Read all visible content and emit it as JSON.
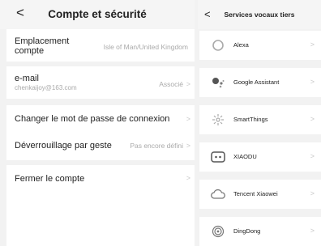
{
  "left": {
    "back": "<",
    "title": "Compte et sécurité",
    "location": {
      "label": "Emplacement compte",
      "value": "Isle of Man/United Kingdom"
    },
    "email": {
      "label": "e-mail",
      "address": "chenkaijoy@163.com",
      "status": "Associé",
      "chevron": ">"
    },
    "change_password": {
      "label": "Changer le mot de passe de connexion",
      "chevron": ">"
    },
    "gesture_unlock": {
      "label": "Déverrouillage par geste",
      "value": "Pas encore défini",
      "chevron": ">"
    },
    "close_account": {
      "label": "Fermer le compte",
      "chevron": ">"
    }
  },
  "right": {
    "back": "<",
    "title": "Services vocaux tiers",
    "services": [
      {
        "name": "Alexa",
        "icon": "alexa-ring-icon",
        "chevron": ">"
      },
      {
        "name": "Google Assistant",
        "icon": "google-assistant-dots-icon",
        "chevron": ">"
      },
      {
        "name": "SmartThings",
        "icon": "smartthings-icon",
        "chevron": ">"
      },
      {
        "name": "XIAODU",
        "icon": "xiaodu-icon",
        "chevron": ">"
      },
      {
        "name": "Tencent Xiaowei",
        "icon": "tencent-xiaowei-cloud-icon",
        "chevron": ">"
      },
      {
        "name": "DingDong",
        "icon": "dingdong-icon",
        "chevron": ">"
      }
    ]
  }
}
